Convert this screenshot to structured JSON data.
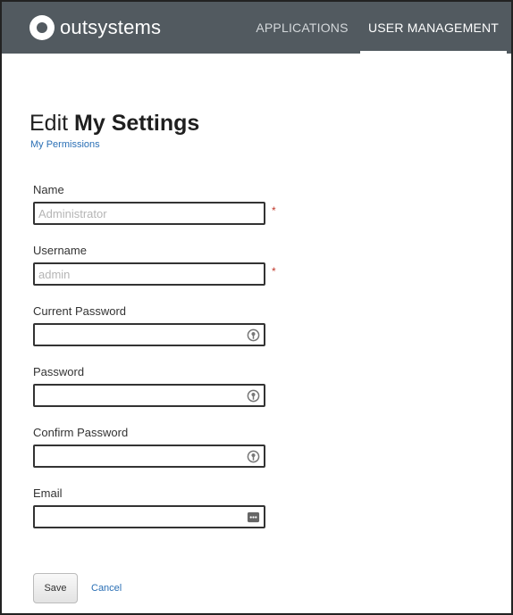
{
  "header": {
    "logo_text": "outsystems",
    "nav": [
      {
        "label": "APPLICATIONS",
        "active": false
      },
      {
        "label": "USER MANAGEMENT",
        "active": true
      }
    ]
  },
  "page": {
    "title_light": "Edit ",
    "title_strong": "My Settings",
    "permissions_link": "My Permissions"
  },
  "form": {
    "name": {
      "label": "Name",
      "value": "",
      "placeholder": "Administrator",
      "required_mark": "*"
    },
    "username": {
      "label": "Username",
      "value": "",
      "placeholder": "admin",
      "required_mark": "*"
    },
    "current_password": {
      "label": "Current Password",
      "icon": "key-icon"
    },
    "password": {
      "label": "Password",
      "icon": "key-icon"
    },
    "confirm_password": {
      "label": "Confirm Password",
      "icon": "key-icon"
    },
    "email": {
      "label": "Email",
      "icon": "autofill-icon"
    }
  },
  "actions": {
    "save_label": "Save",
    "cancel_label": "Cancel"
  },
  "colors": {
    "header_bg": "#525a60",
    "link": "#2a6fb5",
    "required": "#c0392b"
  }
}
